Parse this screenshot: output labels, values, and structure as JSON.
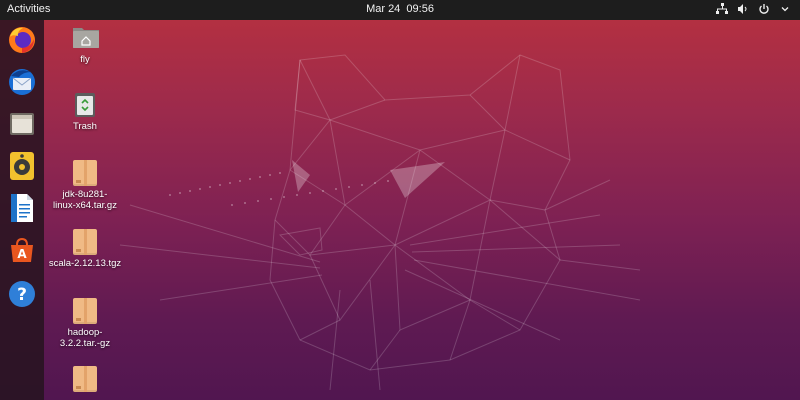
{
  "topbar": {
    "activities": "Activities",
    "datetime": "Mar 24  09:56",
    "tray_icons": [
      "network-icon",
      "volume-icon",
      "power-icon"
    ]
  },
  "dock": {
    "items": [
      {
        "name": "firefox",
        "icon": "firefox-icon"
      },
      {
        "name": "thunderbird",
        "icon": "thunderbird-icon"
      },
      {
        "name": "files",
        "icon": "files-icon"
      },
      {
        "name": "rhythmbox",
        "icon": "rhythmbox-icon"
      },
      {
        "name": "writer",
        "icon": "writer-icon"
      },
      {
        "name": "software",
        "icon": "software-icon"
      },
      {
        "name": "help",
        "icon": "help-icon"
      }
    ]
  },
  "desktop": {
    "icons": [
      {
        "label": "fly",
        "type": "home-folder"
      },
      {
        "label": "Trash",
        "type": "trash"
      },
      {
        "label": "jdk-8u281-linux-x64.tar.gz",
        "type": "package"
      },
      {
        "label": "scala-2.12.13.tgz",
        "type": "package"
      },
      {
        "label": "hadoop-3.2.2.tar.-gz",
        "type": "package"
      },
      {
        "label": "",
        "type": "package"
      }
    ]
  },
  "colors": {
    "wallpaper_top": "#b8313f",
    "wallpaper_bottom": "#511650",
    "topbar": "#1d1d1d",
    "dock": "#26141f"
  }
}
